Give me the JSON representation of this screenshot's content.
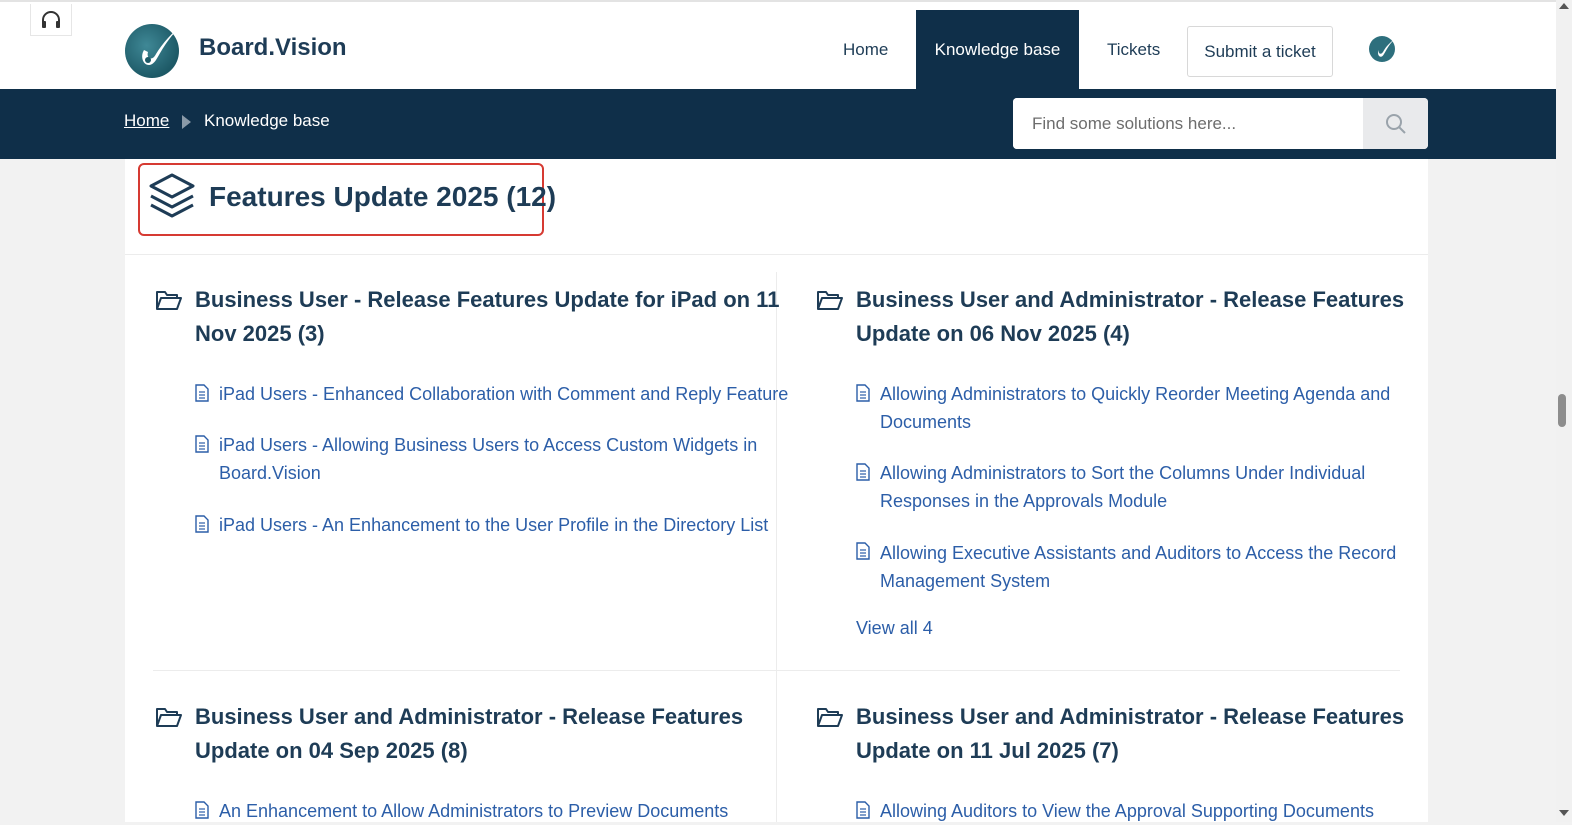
{
  "header": {
    "brand": "Board.Vision",
    "nav": {
      "home": "Home",
      "knowledge_base": "Knowledge base",
      "tickets": "Tickets",
      "submit_ticket": "Submit a ticket"
    }
  },
  "subbar": {
    "breadcrumb_home": "Home",
    "breadcrumb_current": "Knowledge base",
    "search_placeholder": "Find some solutions here..."
  },
  "category": {
    "title": "Features Update 2025 (12)",
    "folders": [
      {
        "title_line1": "Business User - Release Features Update for iPad on 11",
        "title_line2": "Nov 2025 (3)",
        "articles": [
          {
            "line1": "iPad Users - Enhanced Collaboration with Comment and Reply Feature",
            "line2": ""
          },
          {
            "line1": "iPad Users - Allowing Business Users to Access Custom Widgets in",
            "line2": "Board.Vision"
          },
          {
            "line1": "iPad Users - An Enhancement to the User Profile in the Directory List",
            "line2": ""
          }
        ]
      },
      {
        "title_line1": "Business User and Administrator - Release Features",
        "title_line2": "Update on 06 Nov 2025 (4)",
        "articles": [
          {
            "line1": "Allowing Administrators to Quickly Reorder Meeting Agenda and",
            "line2": "Documents"
          },
          {
            "line1": "Allowing Administrators to Sort the Columns Under Individual",
            "line2": "Responses in the Approvals Module"
          },
          {
            "line1": "Allowing Executive Assistants and Auditors to Access the Record",
            "line2": "Management System"
          }
        ],
        "view_all": "View all 4"
      },
      {
        "title_line1": "Business User and Administrator - Release Features",
        "title_line2": "Update on 04 Sep 2025 (8)",
        "articles": [
          {
            "line1": "An Enhancement to Allow Administrators to Preview Documents",
            "line2": ""
          }
        ]
      },
      {
        "title_line1": "Business User and Administrator - Release Features",
        "title_line2": "Update on 11 Jul 2025 (7)",
        "articles": [
          {
            "line1": "Allowing Auditors to View the Approval Supporting Documents",
            "line2": ""
          }
        ]
      }
    ]
  },
  "colors": {
    "navy": "#0f2f49",
    "title_text": "#1e3c56",
    "link": "#2c5ea8",
    "highlight": "#d63a32"
  },
  "icons": [
    "headset-icon",
    "logo-icon",
    "search-icon",
    "layers-icon",
    "folder-open-icon",
    "document-icon"
  ]
}
